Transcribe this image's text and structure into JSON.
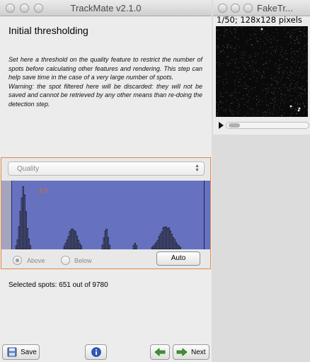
{
  "main_window": {
    "title": "TrackMate v2.1.0",
    "heading": "Initial thresholding",
    "description_1": "Set here a threshold on the quality feature to restrict the number of spots before calculating other features and rendering. This step can help save time in the case of a very large number of spots.",
    "description_2": "Warning: the spot filtered here will be discarded: they will not be saved and cannot be retrieved by any other means than re-doing the detection step.",
    "feature_select": "Quality",
    "threshold_label": "2.7",
    "threshold_fraction": 0.02,
    "radio_above": "Above",
    "radio_below": "Below",
    "radio_selected": "Above",
    "auto_button": "Auto",
    "selected_spots": "Selected spots: 651 out of 9780",
    "save_button": "Save",
    "prev_button": "",
    "next_button": "Next",
    "colors": {
      "histogram_bg": "#6672c0",
      "histogram_excluded": "#a4a4bc",
      "threshold_label": "#d06a2e",
      "panel_border": "#e0894a",
      "next_arrow": "#3a9a2a",
      "info_icon": "#2b5cb8"
    }
  },
  "image_window": {
    "title": "FakeTr...",
    "info": "1/50; 128x128 pixels"
  }
}
